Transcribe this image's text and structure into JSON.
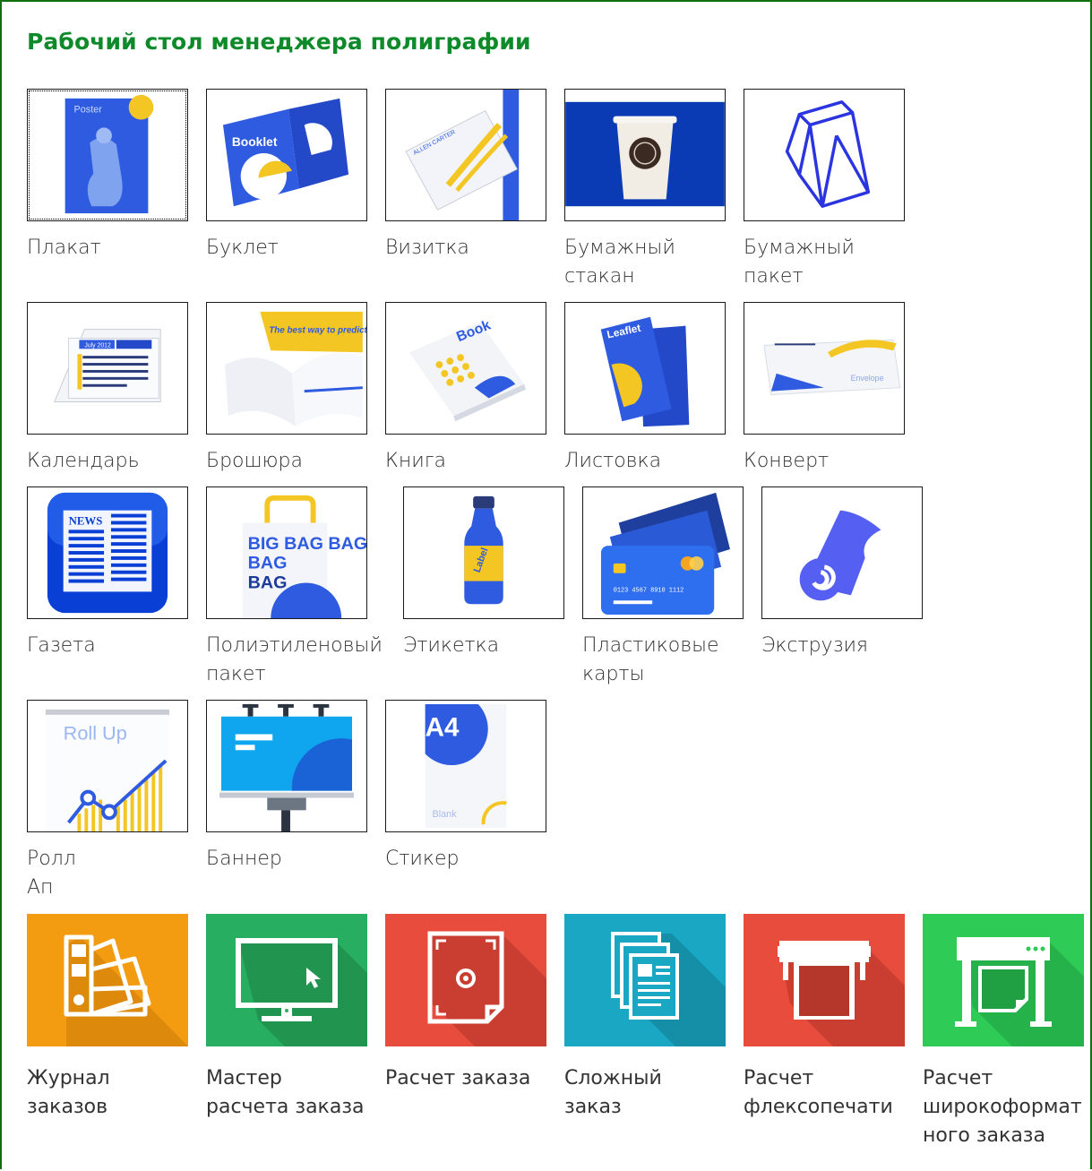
{
  "title": "Рабочий стол менеджера полиграфии",
  "products": [
    {
      "label": "Плакат",
      "icon": "poster-icon",
      "thumb_text": "Poster"
    },
    {
      "label": "Буклет",
      "icon": "booklet-icon",
      "thumb_text": "Booklet"
    },
    {
      "label": "Визитка",
      "icon": "business-card-icon",
      "thumb_text": "ALLEN CARTER"
    },
    {
      "label": "Бумажный\nстакан",
      "icon": "paper-cup-icon"
    },
    {
      "label": "Бумажный\nпакет",
      "icon": "paper-bag-icon"
    },
    {
      "label": "Календарь",
      "icon": "calendar-icon",
      "thumb_text": "July 2012"
    },
    {
      "label": "Брошюра",
      "icon": "brochure-icon",
      "thumb_text": "The best way to predict the future is to create it"
    },
    {
      "label": "Книга",
      "icon": "book-icon",
      "thumb_text": "Book"
    },
    {
      "label": "Листовка",
      "icon": "leaflet-icon",
      "thumb_text": "Leaflet"
    },
    {
      "label": "Конверт",
      "icon": "envelope-icon",
      "thumb_text": "Envelope"
    },
    {
      "label": "Газета",
      "icon": "newspaper-icon",
      "thumb_text": "NEWS"
    },
    {
      "label": "Полиэтиленовый\nпакет",
      "icon": "plastic-bag-icon",
      "thumb_text": "BIG BAG BAG"
    },
    {
      "label": "Этикетка",
      "icon": "label-bottle-icon",
      "thumb_text": "Label"
    },
    {
      "label": "Пластиковые\nкарты",
      "icon": "plastic-card-icon",
      "thumb_text": "0123 4567 8910 1112"
    },
    {
      "label": "Экструзия",
      "icon": "extrusion-roll-icon"
    },
    {
      "label": "Ролл\nАп",
      "icon": "roll-up-icon",
      "thumb_text": "Roll Up"
    },
    {
      "label": "Баннер",
      "icon": "billboard-icon"
    },
    {
      "label": "Стикер",
      "icon": "sticker-icon",
      "thumb_text": "A4",
      "thumb_text2": "Blank"
    }
  ],
  "functions": [
    {
      "label": "Журнал\nзаказов",
      "icon": "swatch-book-icon",
      "color": "#f39c12"
    },
    {
      "label": "Мастер\nрасчета заказа",
      "icon": "monitor-cursor-icon",
      "color": "#27ae60"
    },
    {
      "label": "Расчет заказа",
      "icon": "print-layout-icon",
      "color": "#e74c3c"
    },
    {
      "label": "Сложный\nзаказ",
      "icon": "stacked-documents-icon",
      "color": "#1aa7c4"
    },
    {
      "label": "Расчет\nфлексопечати",
      "icon": "flexo-printer-icon",
      "color": "#e74c3c"
    },
    {
      "label": "Расчет\nширокоформат\nного заказа",
      "icon": "plotter-icon",
      "color": "#2ecc57"
    }
  ]
}
